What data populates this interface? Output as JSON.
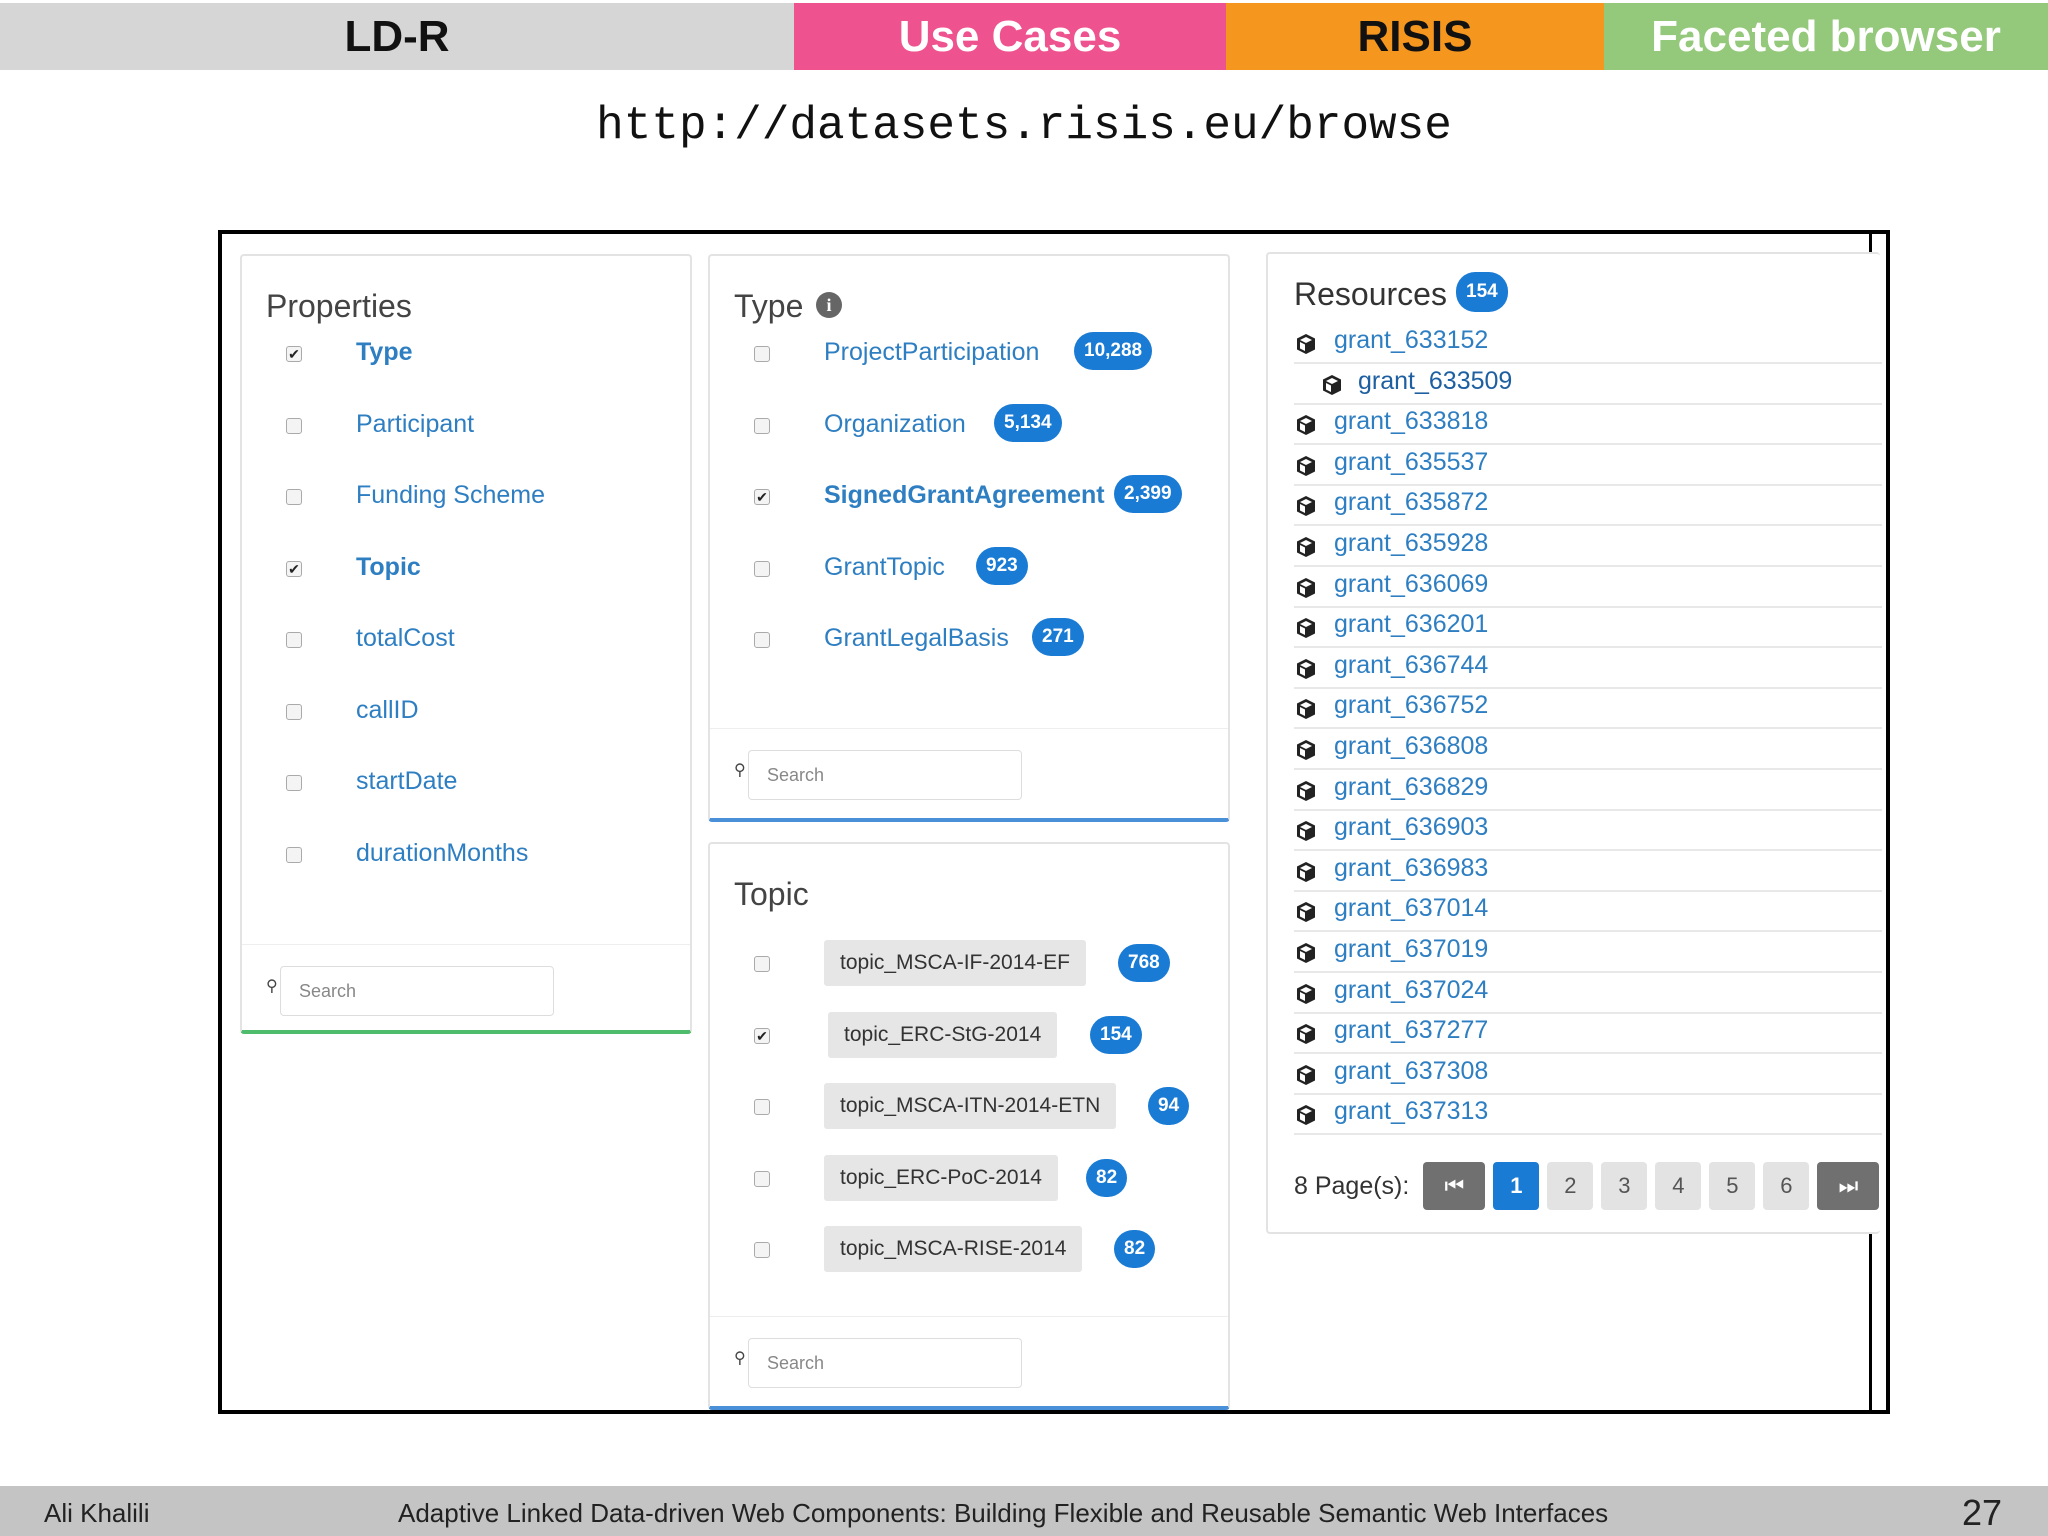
{
  "topbar": {
    "ldr": "LD-R",
    "use_cases": "Use Cases",
    "risis": "RISIS",
    "faceted": "Faceted browser"
  },
  "url": "http://datasets.risis.eu/browse",
  "properties": {
    "title": "Properties",
    "items": [
      {
        "label": "Type",
        "checked": true
      },
      {
        "label": "Participant",
        "checked": false
      },
      {
        "label": "Funding Scheme",
        "checked": false
      },
      {
        "label": "Topic",
        "checked": true
      },
      {
        "label": "totalCost",
        "checked": false
      },
      {
        "label": "callID",
        "checked": false
      },
      {
        "label": "startDate",
        "checked": false
      },
      {
        "label": "durationMonths",
        "checked": false
      }
    ],
    "search_placeholder": "Search"
  },
  "type_facet": {
    "title": "Type",
    "items": [
      {
        "label": "ProjectParticipation",
        "count": "10,288",
        "checked": false
      },
      {
        "label": "Organization",
        "count": "5,134",
        "checked": false
      },
      {
        "label": "SignedGrantAgreement",
        "count": "2,399",
        "checked": true
      },
      {
        "label": "GrantTopic",
        "count": "923",
        "checked": false
      },
      {
        "label": "GrantLegalBasis",
        "count": "271",
        "checked": false
      }
    ],
    "search_placeholder": "Search"
  },
  "topic_facet": {
    "title": "Topic",
    "items": [
      {
        "label": "topic_MSCA-IF-2014-EF",
        "count": "768",
        "checked": false
      },
      {
        "label": "topic_ERC-StG-2014",
        "count": "154",
        "checked": true
      },
      {
        "label": "topic_MSCA-ITN-2014-ETN",
        "count": "94",
        "checked": false
      },
      {
        "label": "topic_ERC-PoC-2014",
        "count": "82",
        "checked": false
      },
      {
        "label": "topic_MSCA-RISE-2014",
        "count": "82",
        "checked": false
      }
    ],
    "search_placeholder": "Search"
  },
  "resources": {
    "title": "Resources",
    "count": "154",
    "items": [
      "grant_633152",
      "grant_633509",
      "grant_633818",
      "grant_635537",
      "grant_635872",
      "grant_635928",
      "grant_636069",
      "grant_636201",
      "grant_636744",
      "grant_636752",
      "grant_636808",
      "grant_636829",
      "grant_636903",
      "grant_636983",
      "grant_637014",
      "grant_637019",
      "grant_637024",
      "grant_637277",
      "grant_637308",
      "grant_637313"
    ],
    "pager": {
      "label": "8 Page(s):",
      "pages": [
        "1",
        "2",
        "3",
        "4",
        "5",
        "6"
      ],
      "current": "1"
    }
  },
  "footer": {
    "author": "Ali Khalili",
    "title": "Adaptive Linked Data-driven Web Components: Building Flexible and Reusable Semantic Web Interfaces",
    "page": "27"
  }
}
